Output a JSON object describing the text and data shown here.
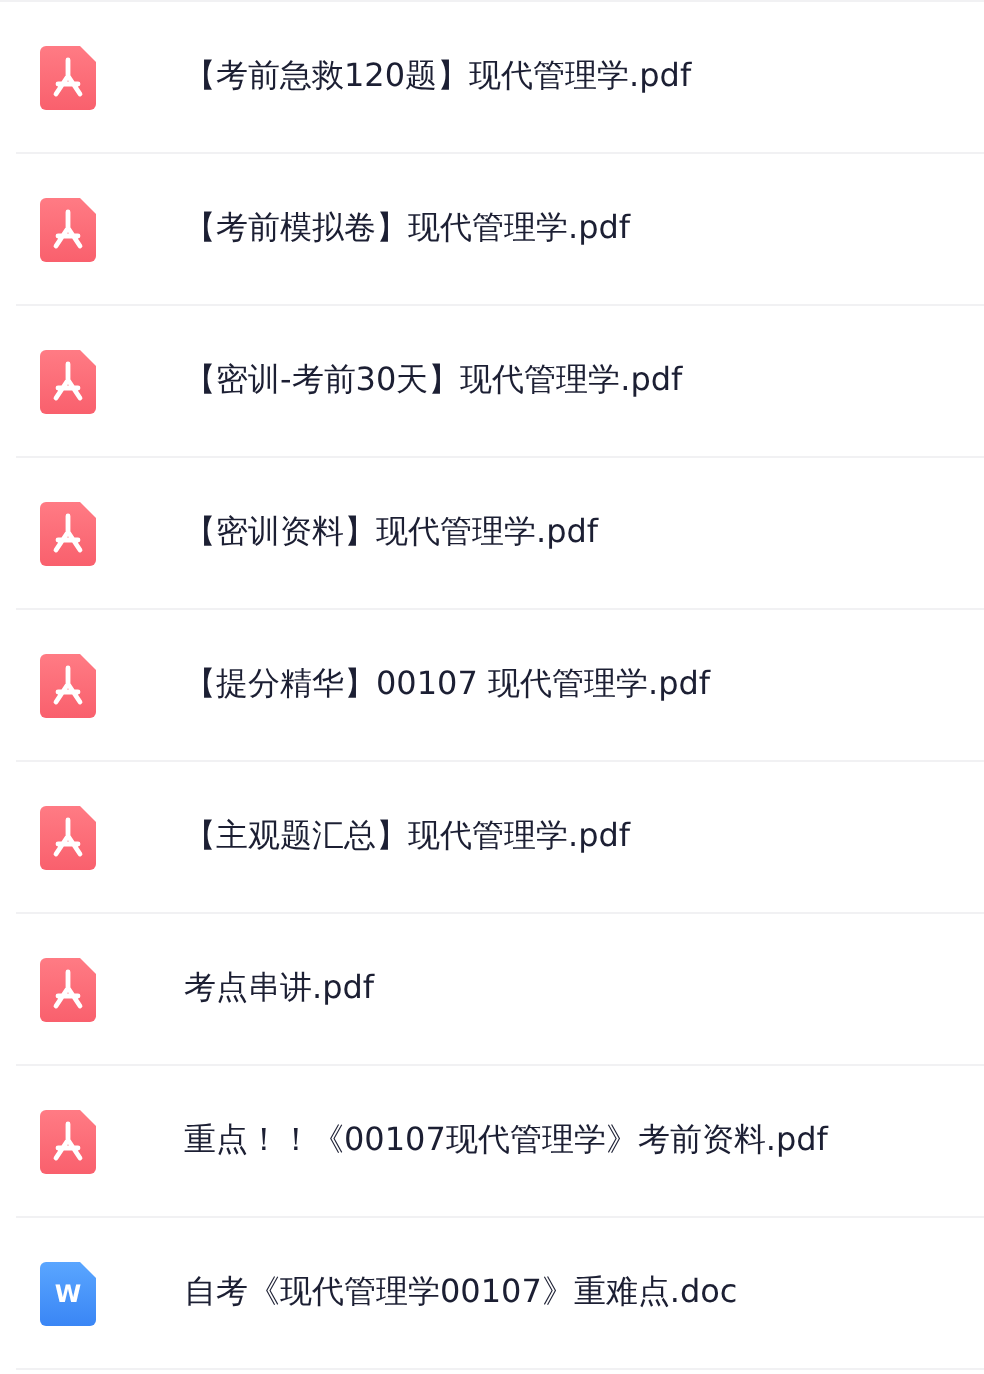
{
  "files": [
    {
      "kind": "pdf",
      "name": "【考前急救120题】现代管理学.pdf"
    },
    {
      "kind": "pdf",
      "name": "【考前模拟卷】现代管理学.pdf"
    },
    {
      "kind": "pdf",
      "name": "【密训-考前30天】现代管理学.pdf"
    },
    {
      "kind": "pdf",
      "name": "【密训资料】现代管理学.pdf"
    },
    {
      "kind": "pdf",
      "name": "【提分精华】00107 现代管理学.pdf"
    },
    {
      "kind": "pdf",
      "name": "【主观题汇总】现代管理学.pdf"
    },
    {
      "kind": "pdf",
      "name": "考点串讲.pdf"
    },
    {
      "kind": "pdf",
      "name": "重点！！《00107现代管理学》考前资料.pdf"
    },
    {
      "kind": "doc",
      "badge": "W",
      "name": "自考《现代管理学00107》重难点.doc"
    }
  ]
}
